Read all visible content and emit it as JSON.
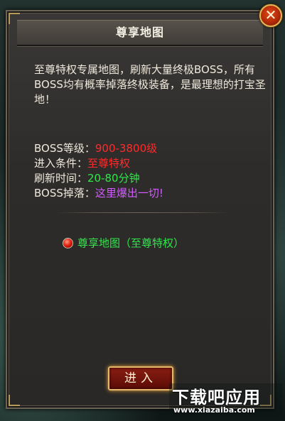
{
  "dialog": {
    "title": "尊享地图",
    "close_label": "✕",
    "description": "至尊特权专属地图，刷新大量终极BOSS，所有BOSS均有概率掉落终极装备，是最理想的打宝圣地！",
    "info": [
      {
        "label": "BOSS等级：",
        "value": "900-3800级",
        "color": "#ff2a2a"
      },
      {
        "label": "进入条件：",
        "value": "至尊特权",
        "color": "#ff2a2a"
      },
      {
        "label": "刷新时间：",
        "value": "20-80分钟",
        "color": "#2ee84a"
      },
      {
        "label": "BOSS掉落：",
        "value": "这里爆出一切!",
        "color": "#d25cff"
      }
    ],
    "option_label": "尊享地图（至尊特权）",
    "enter_label": "进入"
  },
  "watermark": {
    "title": "下载吧应用",
    "url": "www.xiazaiba.com"
  }
}
